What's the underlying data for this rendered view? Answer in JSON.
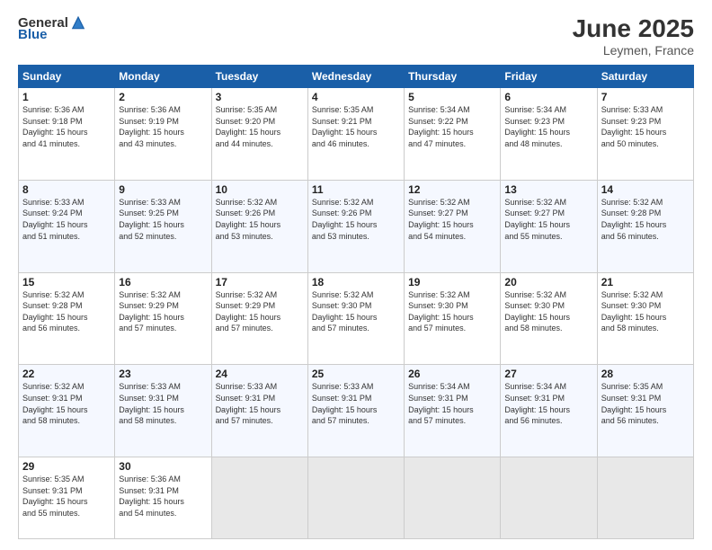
{
  "logo": {
    "general": "General",
    "blue": "Blue"
  },
  "title": "June 2025",
  "location": "Leymen, France",
  "headers": [
    "Sunday",
    "Monday",
    "Tuesday",
    "Wednesday",
    "Thursday",
    "Friday",
    "Saturday"
  ],
  "rows": [
    [
      {
        "day": "1",
        "info": "Sunrise: 5:36 AM\nSunset: 9:18 PM\nDaylight: 15 hours\nand 41 minutes."
      },
      {
        "day": "2",
        "info": "Sunrise: 5:36 AM\nSunset: 9:19 PM\nDaylight: 15 hours\nand 43 minutes."
      },
      {
        "day": "3",
        "info": "Sunrise: 5:35 AM\nSunset: 9:20 PM\nDaylight: 15 hours\nand 44 minutes."
      },
      {
        "day": "4",
        "info": "Sunrise: 5:35 AM\nSunset: 9:21 PM\nDaylight: 15 hours\nand 46 minutes."
      },
      {
        "day": "5",
        "info": "Sunrise: 5:34 AM\nSunset: 9:22 PM\nDaylight: 15 hours\nand 47 minutes."
      },
      {
        "day": "6",
        "info": "Sunrise: 5:34 AM\nSunset: 9:23 PM\nDaylight: 15 hours\nand 48 minutes."
      },
      {
        "day": "7",
        "info": "Sunrise: 5:33 AM\nSunset: 9:23 PM\nDaylight: 15 hours\nand 50 minutes."
      }
    ],
    [
      {
        "day": "8",
        "info": "Sunrise: 5:33 AM\nSunset: 9:24 PM\nDaylight: 15 hours\nand 51 minutes."
      },
      {
        "day": "9",
        "info": "Sunrise: 5:33 AM\nSunset: 9:25 PM\nDaylight: 15 hours\nand 52 minutes."
      },
      {
        "day": "10",
        "info": "Sunrise: 5:32 AM\nSunset: 9:26 PM\nDaylight: 15 hours\nand 53 minutes."
      },
      {
        "day": "11",
        "info": "Sunrise: 5:32 AM\nSunset: 9:26 PM\nDaylight: 15 hours\nand 53 minutes."
      },
      {
        "day": "12",
        "info": "Sunrise: 5:32 AM\nSunset: 9:27 PM\nDaylight: 15 hours\nand 54 minutes."
      },
      {
        "day": "13",
        "info": "Sunrise: 5:32 AM\nSunset: 9:27 PM\nDaylight: 15 hours\nand 55 minutes."
      },
      {
        "day": "14",
        "info": "Sunrise: 5:32 AM\nSunset: 9:28 PM\nDaylight: 15 hours\nand 56 minutes."
      }
    ],
    [
      {
        "day": "15",
        "info": "Sunrise: 5:32 AM\nSunset: 9:28 PM\nDaylight: 15 hours\nand 56 minutes."
      },
      {
        "day": "16",
        "info": "Sunrise: 5:32 AM\nSunset: 9:29 PM\nDaylight: 15 hours\nand 57 minutes."
      },
      {
        "day": "17",
        "info": "Sunrise: 5:32 AM\nSunset: 9:29 PM\nDaylight: 15 hours\nand 57 minutes."
      },
      {
        "day": "18",
        "info": "Sunrise: 5:32 AM\nSunset: 9:30 PM\nDaylight: 15 hours\nand 57 minutes."
      },
      {
        "day": "19",
        "info": "Sunrise: 5:32 AM\nSunset: 9:30 PM\nDaylight: 15 hours\nand 57 minutes."
      },
      {
        "day": "20",
        "info": "Sunrise: 5:32 AM\nSunset: 9:30 PM\nDaylight: 15 hours\nand 58 minutes."
      },
      {
        "day": "21",
        "info": "Sunrise: 5:32 AM\nSunset: 9:30 PM\nDaylight: 15 hours\nand 58 minutes."
      }
    ],
    [
      {
        "day": "22",
        "info": "Sunrise: 5:32 AM\nSunset: 9:31 PM\nDaylight: 15 hours\nand 58 minutes."
      },
      {
        "day": "23",
        "info": "Sunrise: 5:33 AM\nSunset: 9:31 PM\nDaylight: 15 hours\nand 58 minutes."
      },
      {
        "day": "24",
        "info": "Sunrise: 5:33 AM\nSunset: 9:31 PM\nDaylight: 15 hours\nand 57 minutes."
      },
      {
        "day": "25",
        "info": "Sunrise: 5:33 AM\nSunset: 9:31 PM\nDaylight: 15 hours\nand 57 minutes."
      },
      {
        "day": "26",
        "info": "Sunrise: 5:34 AM\nSunset: 9:31 PM\nDaylight: 15 hours\nand 57 minutes."
      },
      {
        "day": "27",
        "info": "Sunrise: 5:34 AM\nSunset: 9:31 PM\nDaylight: 15 hours\nand 56 minutes."
      },
      {
        "day": "28",
        "info": "Sunrise: 5:35 AM\nSunset: 9:31 PM\nDaylight: 15 hours\nand 56 minutes."
      }
    ],
    [
      {
        "day": "29",
        "info": "Sunrise: 5:35 AM\nSunset: 9:31 PM\nDaylight: 15 hours\nand 55 minutes."
      },
      {
        "day": "30",
        "info": "Sunrise: 5:36 AM\nSunset: 9:31 PM\nDaylight: 15 hours\nand 54 minutes."
      },
      {
        "day": "",
        "info": ""
      },
      {
        "day": "",
        "info": ""
      },
      {
        "day": "",
        "info": ""
      },
      {
        "day": "",
        "info": ""
      },
      {
        "day": "",
        "info": ""
      }
    ]
  ]
}
